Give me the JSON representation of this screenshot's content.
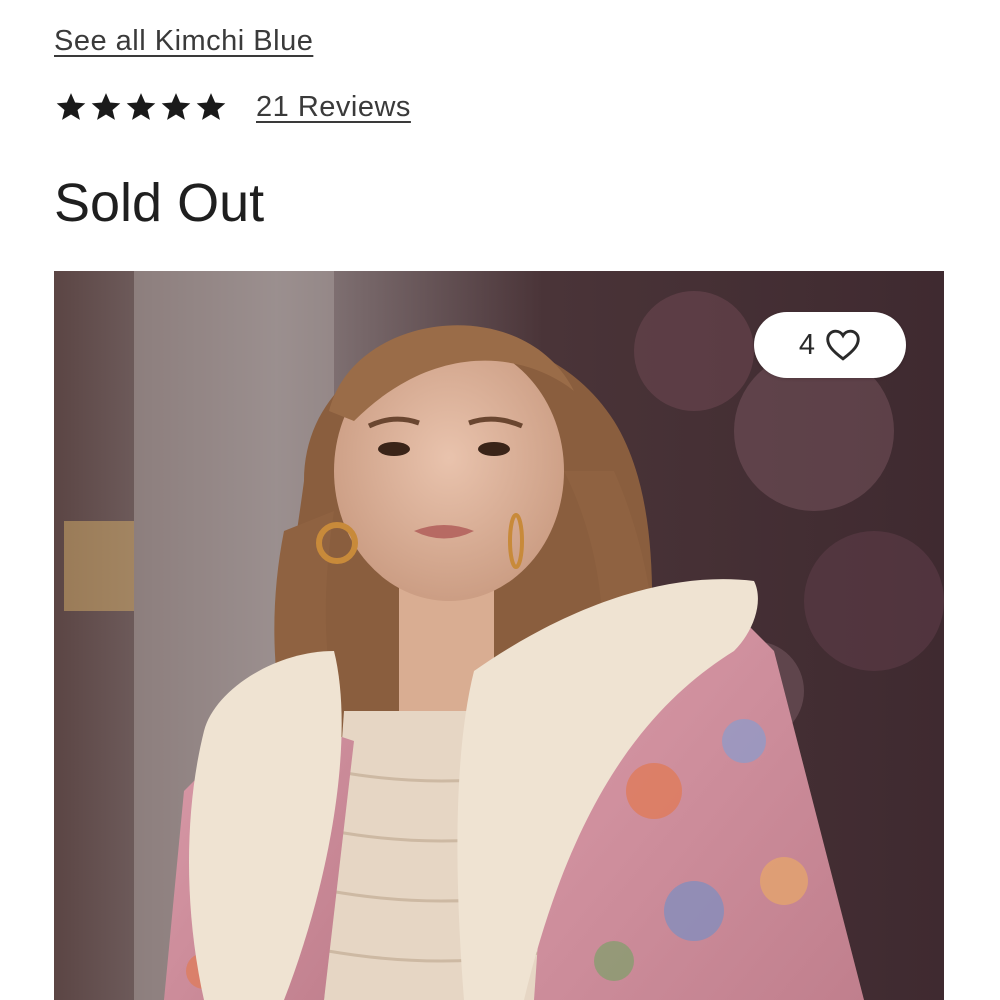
{
  "brand": {
    "see_all_label": "See all Kimchi Blue"
  },
  "rating": {
    "stars": 5,
    "max_stars": 5,
    "reviews_label": "21 Reviews"
  },
  "availability": {
    "status": "Sold Out"
  },
  "product_image": {
    "favorites_count": "4",
    "favorite_icon": "heart-outline-icon"
  },
  "colors": {
    "star": "#1a1a1a",
    "link": "#3a3a3a"
  }
}
